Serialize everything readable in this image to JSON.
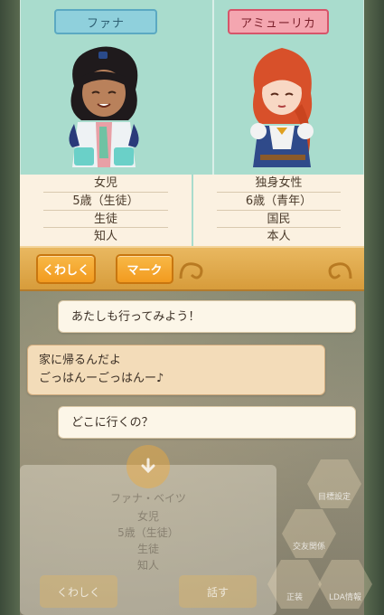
{
  "profiles": {
    "left": {
      "name": "ファナ",
      "info": [
        "女児",
        "5歳（生徒）",
        "生徒",
        "知人"
      ]
    },
    "right": {
      "name": "アミューリカ",
      "info": [
        "独身女性",
        "6歳（青年）",
        "国民",
        "本人"
      ]
    }
  },
  "buttons": {
    "details": "くわしく",
    "mark": "マーク"
  },
  "dialog": {
    "line1": "あたしも行ってみよう！",
    "line2a": "家に帰るんだよ",
    "line2b": "ごっはんーごっはんー♪",
    "line3": "どこに行くの？"
  },
  "background_card": {
    "name": "ファナ・ベイツ",
    "info": [
      "女児",
      "5歳（生徒）",
      "生徒",
      "知人"
    ],
    "details": "くわしく",
    "talk": "話す"
  },
  "side_menu": {
    "item1": "目標設定",
    "item2": "交友関係",
    "item3": "正装",
    "item4": "LDA情報"
  },
  "colors": {
    "left_badge": "#8fd0dc",
    "right_badge": "#f4a6b0",
    "panel_bg": "#a9dccd",
    "accent_orange": "#f29a1f"
  }
}
